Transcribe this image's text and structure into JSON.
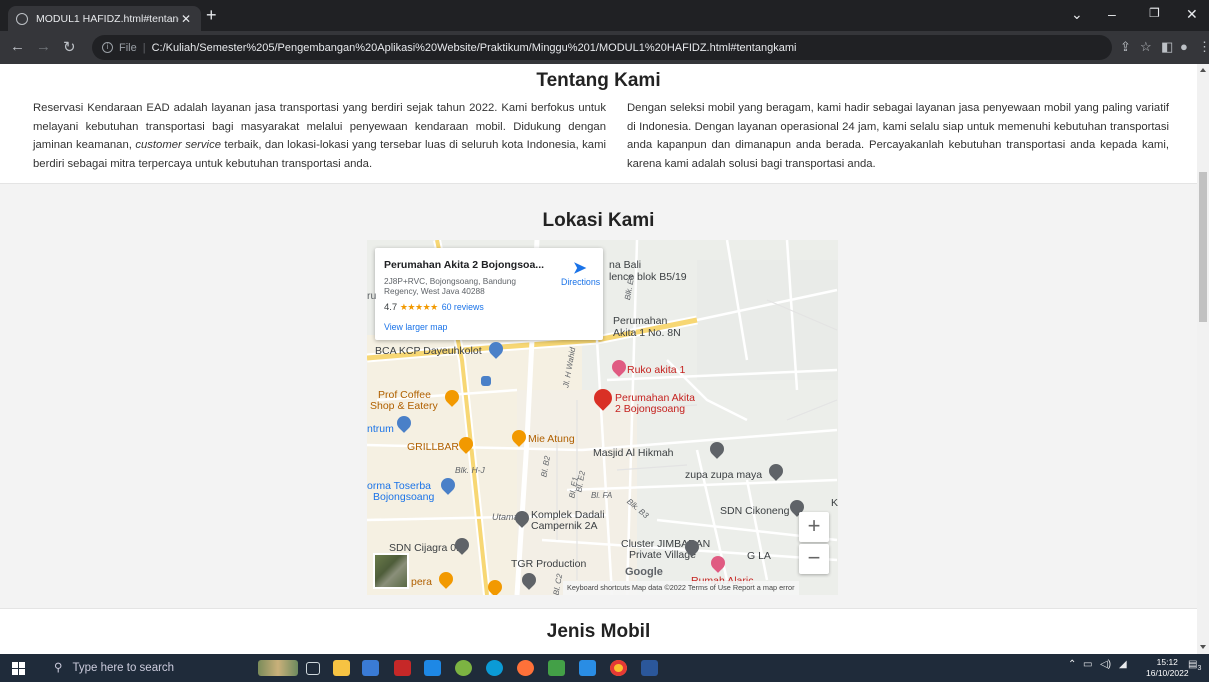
{
  "browser": {
    "tab_title": "MODUL1 HAFIDZ.html#tentangk",
    "new_tab": "+",
    "address_scheme": "File",
    "address_url": "C:/Kuliah/Semester%205/Pengembangan%20Aplikasi%20Website/Praktikum/Minggu%201/MODUL1%20HAFIDZ.html#tentangkami"
  },
  "about": {
    "title": "Tentang Kami",
    "left_pre": "Reservasi Kendaraan EAD adalah layanan jasa transportasi yang berdiri sejak tahun 2022. Kami berfokus untuk melayani kebutuhan transportasi bagi masyarakat melalui penyewaan kendaraan mobil. Didukung dengan jaminan keamanan, ",
    "left_em": "customer service",
    "left_post": " terbaik, dan lokasi-lokasi yang tersebar luas di seluruh kota Indonesia, kami berdiri sebagai mitra terpercaya untuk kebutuhan transportasi anda.",
    "right": "Dengan seleksi mobil yang beragam, kami hadir sebagai layanan jasa penyewaan mobil yang paling variatif di Indonesia. Dengan layanan operasional 24 jam, kami selalu siap untuk memenuhi kebutuhan transportasi anda kapanpun dan dimanapun anda berada. Percayakanlah kebutuhan transportasi anda kepada kami, karena kami adalah solusi bagi transportasi anda."
  },
  "location": {
    "title": "Lokasi Kami",
    "card": {
      "name": "Perumahan Akita 2 Bojongsoa...",
      "address": "2J8P+RVC, Bojongsoang, Bandung Regency, West Java 40288",
      "rating": "4.7",
      "stars": "★★★★★",
      "reviews": "60 reviews",
      "larger_map": "View larger map",
      "directions": "Directions"
    },
    "places": {
      "bca": "BCA KCP Dayeuhkolot",
      "prof_coffee_1": "Prof Coffee",
      "prof_coffee_2": "Shop & Eatery",
      "sentrum": "ntrum",
      "grillbar": "GRILLBAR",
      "mie": "Mie Atung",
      "forma1": "orma Toserba",
      "forma2": "Bojongsoang",
      "utama": "Utama",
      "komplek1": "Komplek Dadali",
      "komplek2": "Campernik 2A",
      "cijagra": "SDN Cijagra 01",
      "tgr": "TGR Production",
      "cluster1": "Cluster JIMBARAN",
      "cluster2": "Private Village",
      "rumah": "Rumah Alaric",
      "masjid": "Masjid Al Hikmah",
      "zupa": "zupa zupa maya",
      "sdn_cikoneng": "SDN Cikoneng",
      "ruko": "Ruko akita 1",
      "akita_pin1": "Perumahan Akita",
      "akita_pin2": "2 Bojongsoang",
      "akita_n1": "Perumahan",
      "akita_n2": "Akita 1 No. 8N",
      "bali1": "na Bali",
      "bali2": "lence blok B5/19",
      "gla": "G LA",
      "pera": "pera",
      "street_wahid": "Jl. H Wahid",
      "street_blkhj": "Blk. H-J",
      "street_b2": "Bl. B2",
      "street_e1": "Bl. E1",
      "street_e2": "Bl. E2",
      "street_fa": "Bl. FA",
      "street_b3": "Blk. B3",
      "street_c2": "Bl. C2",
      "street_e8": "Blk. E8",
      "ru": "ru",
      "ka": "K",
      "google": "Google"
    },
    "attribution": "Keyboard shortcuts   Map data ©2022   Terms of Use   Report a map error",
    "zoom_in": "+",
    "zoom_out": "−"
  },
  "cars": {
    "title": "Jenis Mobil"
  },
  "taskbar": {
    "search_placeholder": "Type here to search",
    "time": "15:12",
    "date": "16/10/2022",
    "notif_count": "3"
  }
}
